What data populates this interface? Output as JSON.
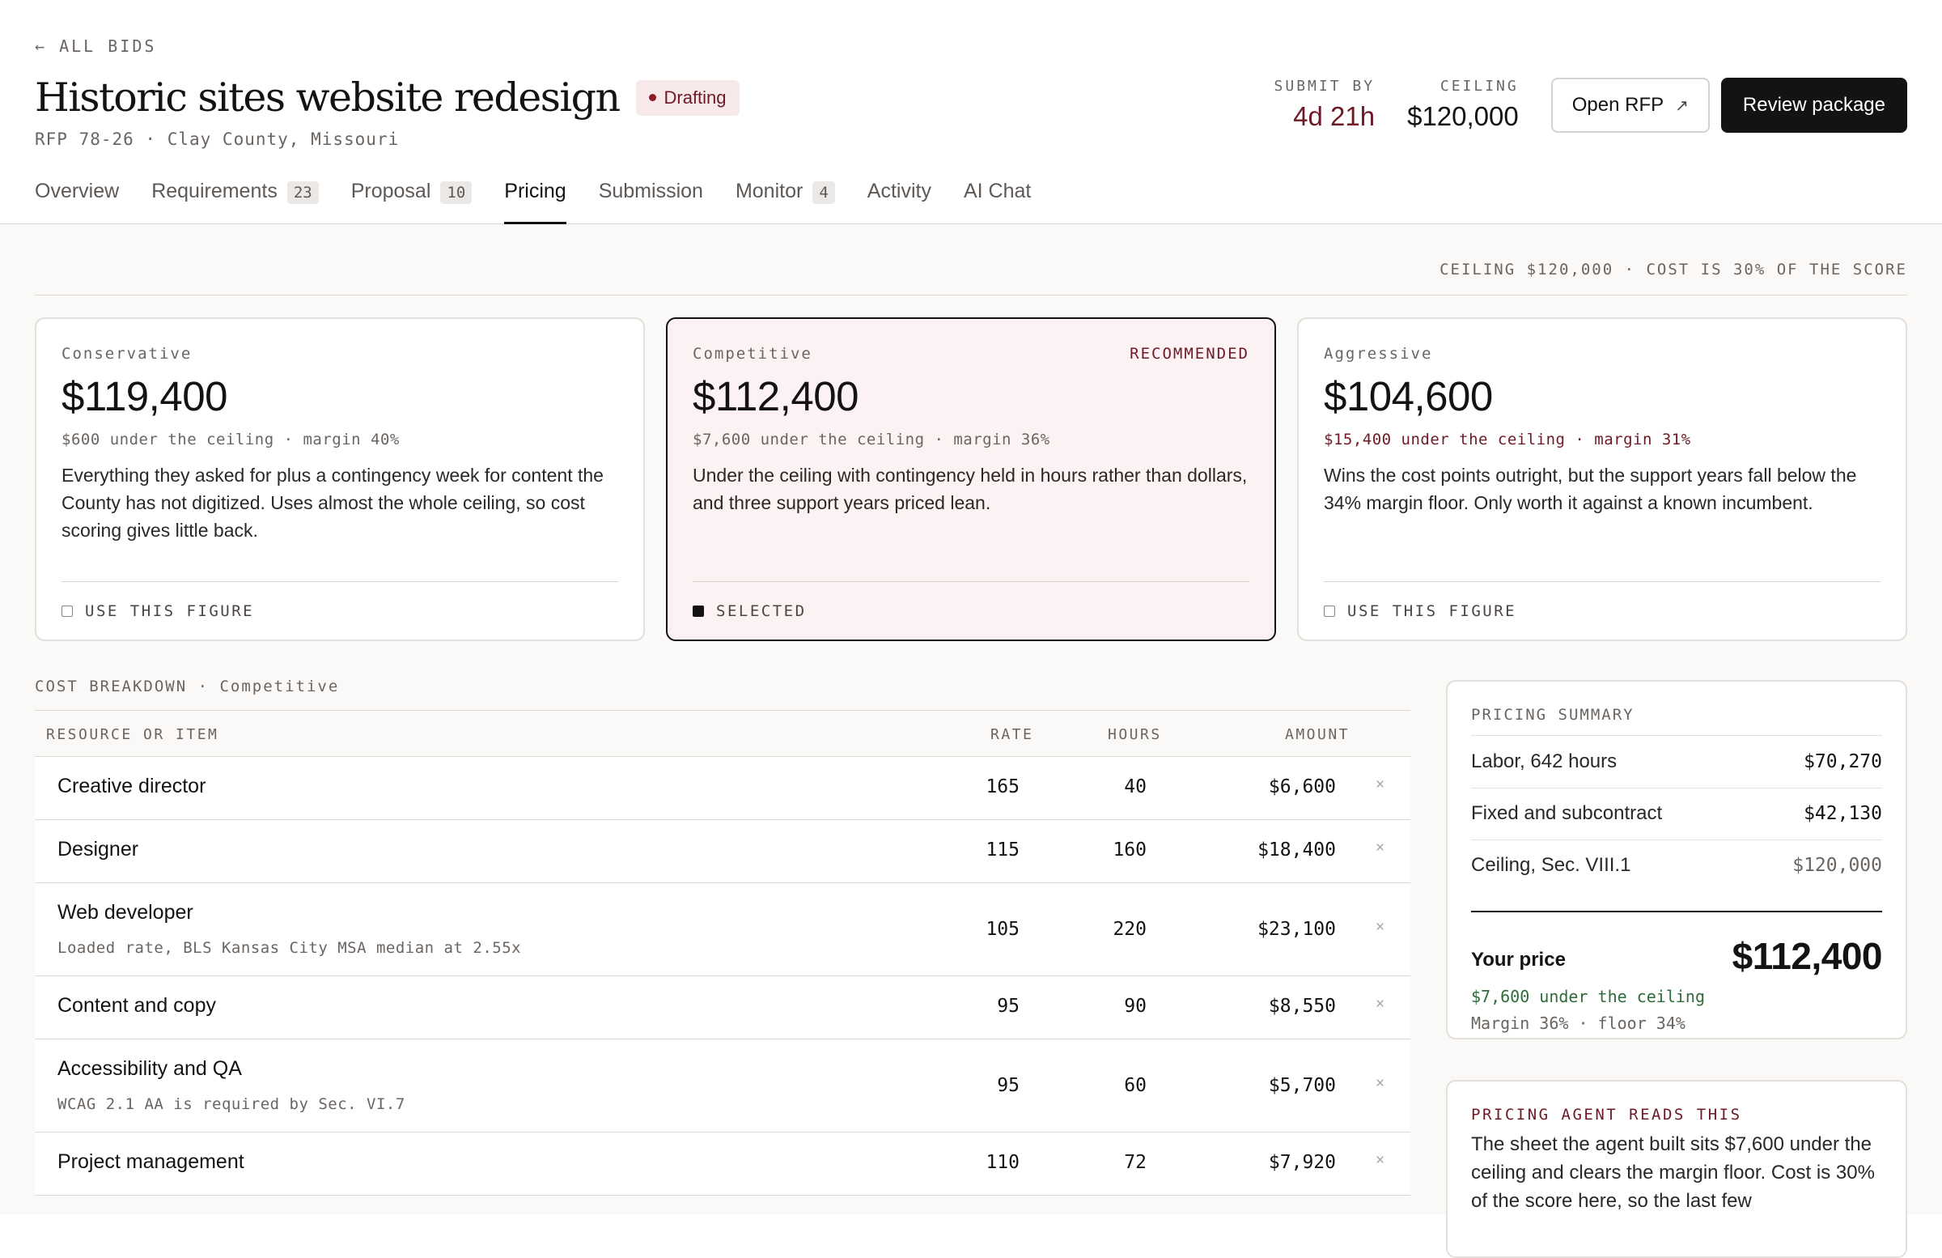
{
  "header": {
    "back_label": "← ALL BIDS",
    "title": "Historic sites website redesign",
    "status": "Drafting",
    "rfp_meta": "RFP 78-26 · Clay County, Missouri",
    "submit_by_label": "SUBMIT BY",
    "submit_by_value": "4d 21h",
    "ceiling_label": "CEILING",
    "ceiling_value": "$120,000",
    "open_rfp_label": "Open RFP",
    "open_rfp_icon": "↗",
    "review_label": "Review package"
  },
  "tabs": [
    {
      "label": "Overview",
      "count": null,
      "active": false
    },
    {
      "label": "Requirements",
      "count": "23",
      "active": false
    },
    {
      "label": "Proposal",
      "count": "10",
      "active": false
    },
    {
      "label": "Pricing",
      "count": null,
      "active": true
    },
    {
      "label": "Submission",
      "count": null,
      "active": false
    },
    {
      "label": "Monitor",
      "count": "4",
      "active": false
    },
    {
      "label": "Activity",
      "count": null,
      "active": false
    },
    {
      "label": "AI Chat",
      "count": null,
      "active": false
    }
  ],
  "ceiling_note": "CEILING $120,000 · COST IS 30% OF THE SCORE",
  "options": [
    {
      "name": "Conservative",
      "badge": "",
      "price": "$119,400",
      "delta": "$600 under the ceiling · margin 40%",
      "description": "Everything they asked for plus a contingency week for content the County has not digitized. Uses almost the whole ceiling, so cost scoring gives little back.",
      "action": "USE THIS FIGURE",
      "selected": false,
      "warn": false
    },
    {
      "name": "Competitive",
      "badge": "RECOMMENDED",
      "price": "$112,400",
      "delta": "$7,600 under the ceiling · margin 36%",
      "description": "Under the ceiling with contingency held in hours rather than dollars, and three support years priced lean.",
      "action": "SELECTED",
      "selected": true,
      "warn": false
    },
    {
      "name": "Aggressive",
      "badge": "",
      "price": "$104,600",
      "delta": "$15,400 under the ceiling · margin 31%",
      "description": "Wins the cost points outright, but the support years fall below the 34% margin floor. Only worth it against a known incumbent.",
      "action": "USE THIS FIGURE",
      "selected": false,
      "warn": true
    }
  ],
  "breakdown": {
    "label": "COST BREAKDOWN · Competitive",
    "headers": {
      "item": "RESOURCE OR ITEM",
      "rate": "RATE",
      "hours": "HOURS",
      "amount": "AMOUNT"
    },
    "remove_icon": "×",
    "rows": [
      {
        "name": "Creative director",
        "note": "",
        "rate": "165",
        "hours": "40",
        "amount": "$6,600"
      },
      {
        "name": "Designer",
        "note": "",
        "rate": "115",
        "hours": "160",
        "amount": "$18,400"
      },
      {
        "name": "Web developer",
        "note": "Loaded rate, BLS Kansas City MSA median at 2.55x",
        "rate": "105",
        "hours": "220",
        "amount": "$23,100"
      },
      {
        "name": "Content and copy",
        "note": "",
        "rate": "95",
        "hours": "90",
        "amount": "$8,550"
      },
      {
        "name": "Accessibility and QA",
        "note": "WCAG 2.1 AA is required by Sec. VI.7",
        "rate": "95",
        "hours": "60",
        "amount": "$5,700"
      },
      {
        "name": "Project management",
        "note": "",
        "rate": "110",
        "hours": "72",
        "amount": "$7,920"
      }
    ]
  },
  "summary": {
    "label": "PRICING SUMMARY",
    "rows": [
      {
        "k": "Labor, 642 hours",
        "v": "$70,270"
      },
      {
        "k": "Fixed and subcontract",
        "v": "$42,130"
      },
      {
        "k": "Ceiling, Sec. VIII.1",
        "v": "$120,000"
      }
    ],
    "your_price_label": "Your price",
    "your_price_value": "$112,400",
    "under": "$7,600 under the ceiling",
    "margin": "Margin 36% · floor 34%"
  },
  "agent": {
    "label": "PRICING AGENT READS THIS",
    "text": "The sheet the agent built sits $7,600 under the ceiling and clears the margin floor. Cost is 30% of the score here, so the last few"
  }
}
